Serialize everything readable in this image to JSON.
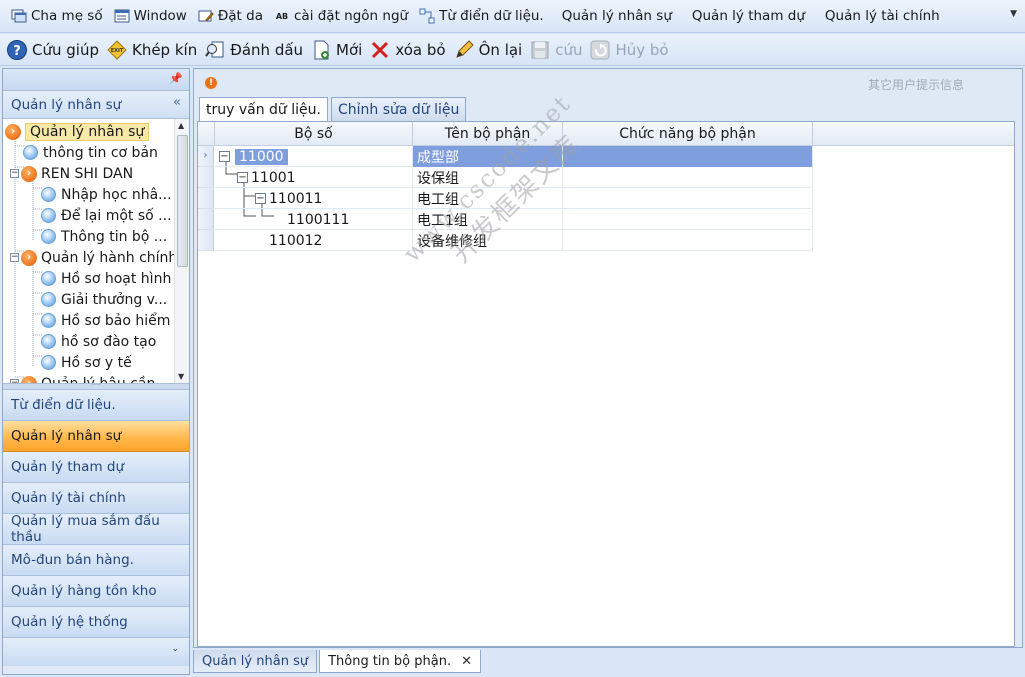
{
  "menubar": {
    "items": [
      {
        "label": "Cha mẹ số",
        "icon": "window-cascade-icon"
      },
      {
        "label": "Window",
        "icon": "window-icon"
      },
      {
        "label": "Đặt da",
        "icon": "skin-icon"
      },
      {
        "label": "cài đặt ngôn ngữ",
        "icon": "language-icon"
      },
      {
        "label": "Từ điển dữ liệu.",
        "icon": "dictionary-icon"
      }
    ],
    "plain_items": [
      "Quản lý nhân sự",
      "Quản lý tham dự",
      "Quản lý tài chính"
    ]
  },
  "toolbar": {
    "help": "Cứu giúp",
    "exit": "Khép kín",
    "mark": "Đánh dấu",
    "new": "Mới",
    "delete": "xóa bỏ",
    "edit": "Ôn lại",
    "save": "cứu",
    "cancel": "Hủy bỏ"
  },
  "nav": {
    "header": "Quản lý nhân sự",
    "tree": [
      {
        "label": "Quản lý nhân sự",
        "level": 0,
        "kind": "orange",
        "selected": true
      },
      {
        "label": "thông tin cơ bản",
        "level": 1,
        "kind": "blue"
      },
      {
        "label": "REN SHI DAN",
        "level": 1,
        "kind": "orange"
      },
      {
        "label": "Nhập học nhâ...",
        "level": 2,
        "kind": "blue"
      },
      {
        "label": "Để lại một số ...",
        "level": 2,
        "kind": "blue"
      },
      {
        "label": "Thông tin bộ ...",
        "level": 2,
        "kind": "blue"
      },
      {
        "label": "Quản lý hành chính",
        "level": 1,
        "kind": "orange"
      },
      {
        "label": "Hồ sơ hoạt hình",
        "level": 2,
        "kind": "blue"
      },
      {
        "label": "Giải thưởng v...",
        "level": 2,
        "kind": "blue"
      },
      {
        "label": "Hồ sơ bảo hiểm",
        "level": 2,
        "kind": "blue"
      },
      {
        "label": "hồ sơ đào tạo",
        "level": 2,
        "kind": "blue"
      },
      {
        "label": "Hồ sơ y tế",
        "level": 2,
        "kind": "blue"
      },
      {
        "label": "Quản lý hậu cần",
        "level": 1,
        "kind": "orange"
      }
    ],
    "groups": [
      {
        "label": "Từ điển dữ liệu.",
        "active": false
      },
      {
        "label": "Quản lý nhân sự",
        "active": true
      },
      {
        "label": "Quản lý tham dự",
        "active": false
      },
      {
        "label": "Quản lý tài chính",
        "active": false
      },
      {
        "label": "Quản lý mua sắm đấu thầu",
        "active": false
      },
      {
        "label": "Mô-đun bán hàng.",
        "active": false
      },
      {
        "label": "Quản lý hàng tồn kho",
        "active": false
      },
      {
        "label": "Quản lý hệ thống",
        "active": false
      }
    ]
  },
  "main": {
    "hint_text": "其它用户提示信息",
    "tabs": [
      "truy vấn dữ liệu.",
      "Chỉnh sửa dữ liệu"
    ],
    "columns": [
      "Bộ số",
      "Tên bộ phận",
      "Chức năng bộ phận"
    ],
    "rows": [
      {
        "code": "11000",
        "name": "成型部",
        "function": "",
        "depth": 0
      },
      {
        "code": "11001",
        "name": "设保组",
        "function": "",
        "depth": 1
      },
      {
        "code": "110011",
        "name": "电工组",
        "function": "",
        "depth": 2
      },
      {
        "code": "1100111",
        "name": "电工1组",
        "function": "",
        "depth": 3
      },
      {
        "code": "110012",
        "name": "设备维修组",
        "function": "",
        "depth": 2
      }
    ]
  },
  "doc_tabs": [
    "Quản lý nhân sự",
    "Thông tin bộ phận."
  ],
  "watermark": {
    "line1": "www.cscode.net",
    "line2": "开发框架文库"
  }
}
